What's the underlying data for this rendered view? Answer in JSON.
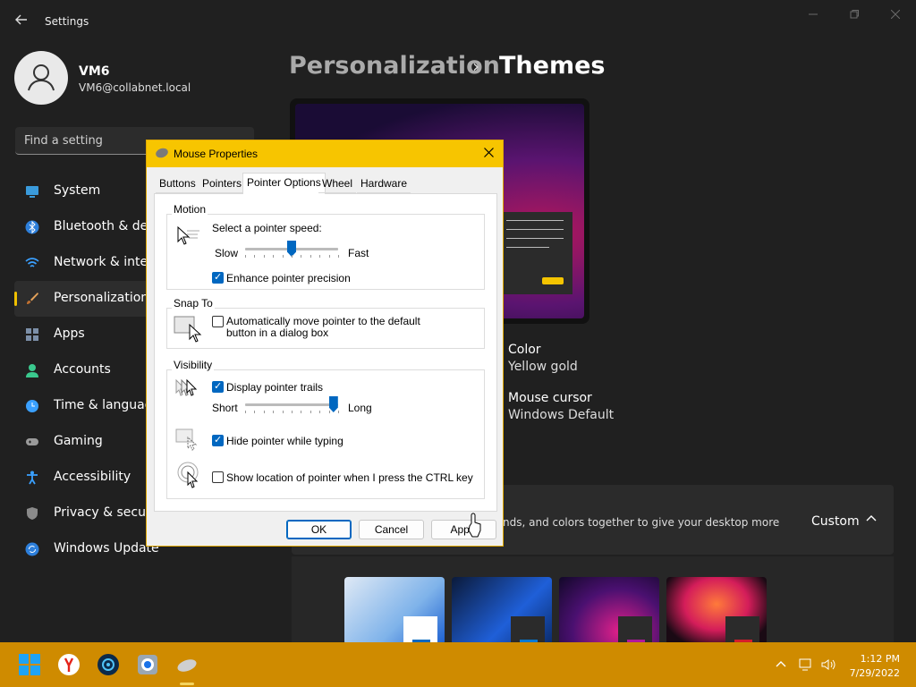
{
  "window": {
    "title": "Settings",
    "back_icon": "arrow-left-icon",
    "minimize_icon": "minimize-icon",
    "maximize_icon": "maximize-icon",
    "close_icon": "close-icon"
  },
  "user": {
    "name": "VM6",
    "email": "VM6@collabnet.local"
  },
  "search": {
    "placeholder": "Find a setting"
  },
  "nav": [
    {
      "label": "System",
      "icon": "monitor-icon",
      "color": "#3a9bdc"
    },
    {
      "label": "Bluetooth & devi",
      "icon": "bluetooth-icon",
      "color": "#2d7fdb"
    },
    {
      "label": "Network & intern",
      "icon": "wifi-icon",
      "color": "#3aa0ff"
    },
    {
      "label": "Personalization",
      "icon": "brush-icon",
      "color": "#e6a35a",
      "active": true
    },
    {
      "label": "Apps",
      "icon": "apps-icon",
      "color": "#7c8fa8"
    },
    {
      "label": "Accounts",
      "icon": "person-icon",
      "color": "#3ac98e"
    },
    {
      "label": "Time & language",
      "icon": "globe-clock-icon",
      "color": "#3aa0ff"
    },
    {
      "label": "Gaming",
      "icon": "gamepad-icon",
      "color": "#9a9a9a"
    },
    {
      "label": "Accessibility",
      "icon": "accessibility-icon",
      "color": "#3aa0ff"
    },
    {
      "label": "Privacy & securit",
      "icon": "shield-icon",
      "color": "#8a8a8a"
    },
    {
      "label": "Windows Update",
      "icon": "update-icon",
      "color": "#2d7fdb"
    }
  ],
  "breadcrumb": {
    "parent": "Personalization",
    "separator": "›",
    "current": "Themes"
  },
  "theme_props": {
    "color_label": "Color",
    "color_value": "Yellow gold",
    "cursor_label": "Mouse cursor",
    "cursor_value": "Windows Default"
  },
  "current_theme": {
    "description": "nds, and colors together to give your desktop more",
    "custom_label": "Custom",
    "chevron_icon": "chevron-up-icon"
  },
  "dialog": {
    "title": "Mouse Properties",
    "tabs": [
      "Buttons",
      "Pointers",
      "Pointer Options",
      "Wheel",
      "Hardware"
    ],
    "selected_tab": "Pointer Options",
    "motion": {
      "group": "Motion",
      "speed_label": "Select a pointer speed:",
      "slow": "Slow",
      "fast": "Fast",
      "speed_level": 0.5,
      "enhance_label": "Enhance pointer precision",
      "enhance_checked": true
    },
    "snap": {
      "group": "Snap To",
      "label": "Automatically move pointer to the default button in a dialog box",
      "checked": false
    },
    "visibility": {
      "group": "Visibility",
      "trails_label": "Display pointer trails",
      "trails_checked": true,
      "short": "Short",
      "long": "Long",
      "trail_level": 0.95,
      "hide_label": "Hide pointer while typing",
      "hide_checked": true,
      "ctrl_label": "Show location of pointer when I press the CTRL key",
      "ctrl_checked": false
    },
    "buttons": {
      "ok": "OK",
      "cancel": "Cancel",
      "apply": "Apply"
    }
  },
  "taskbar": {
    "icons": [
      "windows-start-icon",
      "yandex-browser-icon",
      "app-icon",
      "chrome-icon",
      "mouse-icon"
    ],
    "time": "1:12 PM",
    "date": "7/29/2022"
  },
  "colors": {
    "accent": "#f7c500",
    "taskbar": "#cf8b00",
    "primary_blue": "#0067c0"
  }
}
